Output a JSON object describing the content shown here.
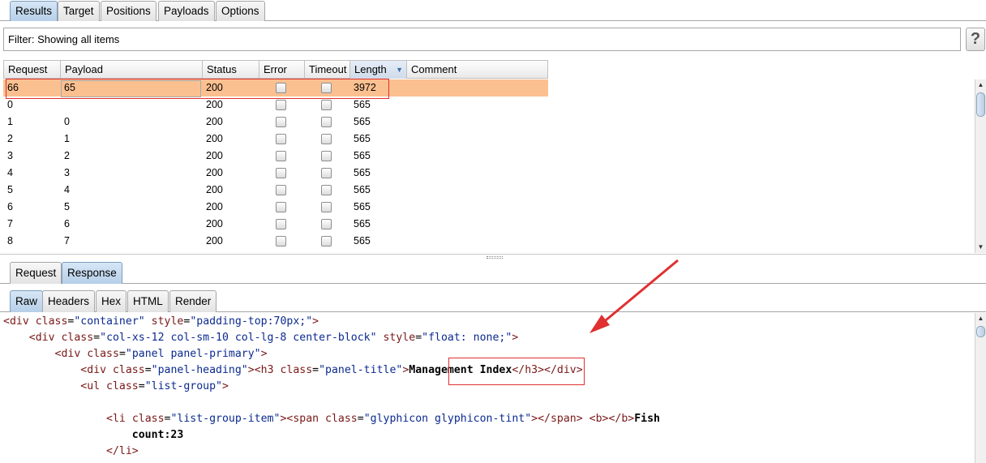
{
  "top_tabs": [
    {
      "label": "Results",
      "active": true
    },
    {
      "label": "Target",
      "active": false
    },
    {
      "label": "Positions",
      "active": false
    },
    {
      "label": "Payloads",
      "active": false
    },
    {
      "label": "Options",
      "active": false
    }
  ],
  "filter": {
    "text": "Filter: Showing all items",
    "help_label": "?"
  },
  "results_table": {
    "columns": [
      "Request",
      "Payload",
      "Status",
      "Error",
      "Timeout",
      "Length",
      "Comment"
    ],
    "sorted_column": "Length",
    "rows": [
      {
        "request": "66",
        "payload": "65",
        "status": "200",
        "error": false,
        "timeout": false,
        "length": "3972",
        "comment": "",
        "selected": true
      },
      {
        "request": "0",
        "payload": "",
        "status": "200",
        "error": false,
        "timeout": false,
        "length": "565",
        "comment": ""
      },
      {
        "request": "1",
        "payload": "0",
        "status": "200",
        "error": false,
        "timeout": false,
        "length": "565",
        "comment": ""
      },
      {
        "request": "2",
        "payload": "1",
        "status": "200",
        "error": false,
        "timeout": false,
        "length": "565",
        "comment": ""
      },
      {
        "request": "3",
        "payload": "2",
        "status": "200",
        "error": false,
        "timeout": false,
        "length": "565",
        "comment": ""
      },
      {
        "request": "4",
        "payload": "3",
        "status": "200",
        "error": false,
        "timeout": false,
        "length": "565",
        "comment": ""
      },
      {
        "request": "5",
        "payload": "4",
        "status": "200",
        "error": false,
        "timeout": false,
        "length": "565",
        "comment": ""
      },
      {
        "request": "6",
        "payload": "5",
        "status": "200",
        "error": false,
        "timeout": false,
        "length": "565",
        "comment": ""
      },
      {
        "request": "7",
        "payload": "6",
        "status": "200",
        "error": false,
        "timeout": false,
        "length": "565",
        "comment": ""
      },
      {
        "request": "8",
        "payload": "7",
        "status": "200",
        "error": false,
        "timeout": false,
        "length": "565",
        "comment": ""
      }
    ]
  },
  "message_tabs": [
    {
      "label": "Request",
      "active": false
    },
    {
      "label": "Response",
      "active": true
    }
  ],
  "view_tabs": [
    {
      "label": "Raw",
      "active": true
    },
    {
      "label": "Headers",
      "active": false
    },
    {
      "label": "Hex",
      "active": false
    },
    {
      "label": "HTML",
      "active": false
    },
    {
      "label": "Render",
      "active": false
    }
  ],
  "response_lines": [
    [
      [
        "t",
        "<div "
      ],
      [
        "a",
        "class"
      ],
      [
        "p",
        "="
      ],
      [
        "v",
        "\"container\""
      ],
      [
        "p",
        " "
      ],
      [
        "a",
        "style"
      ],
      [
        "p",
        "="
      ],
      [
        "v",
        "\"padding-top:70px;\""
      ],
      [
        "t",
        ">"
      ]
    ],
    [
      [
        "p",
        "    "
      ],
      [
        "t",
        "<div "
      ],
      [
        "a",
        "class"
      ],
      [
        "p",
        "="
      ],
      [
        "v",
        "\"col-xs-12 col-sm-10 col-lg-8 center-block\""
      ],
      [
        "p",
        " "
      ],
      [
        "a",
        "style"
      ],
      [
        "p",
        "="
      ],
      [
        "v",
        "\"float: none;\""
      ],
      [
        "t",
        ">"
      ]
    ],
    [
      [
        "p",
        "        "
      ],
      [
        "t",
        "<div "
      ],
      [
        "a",
        "class"
      ],
      [
        "p",
        "="
      ],
      [
        "v",
        "\"panel panel-primary\""
      ],
      [
        "t",
        ">"
      ]
    ],
    [
      [
        "p",
        "            "
      ],
      [
        "t",
        "<div "
      ],
      [
        "a",
        "class"
      ],
      [
        "p",
        "="
      ],
      [
        "v",
        "\"panel-heading\""
      ],
      [
        "t",
        ">"
      ],
      [
        "t",
        "<h3 "
      ],
      [
        "a",
        "class"
      ],
      [
        "p",
        "="
      ],
      [
        "v",
        "\"panel-title\""
      ],
      [
        "t",
        ">"
      ],
      [
        "b",
        "Management Index"
      ],
      [
        "t",
        "</h3>"
      ],
      [
        "t",
        "</div>"
      ]
    ],
    [
      [
        "p",
        "            "
      ],
      [
        "t",
        "<ul "
      ],
      [
        "a",
        "class"
      ],
      [
        "p",
        "="
      ],
      [
        "v",
        "\"list-group\""
      ],
      [
        "t",
        ">"
      ]
    ],
    [
      [
        "p",
        ""
      ]
    ],
    [
      [
        "p",
        "                "
      ],
      [
        "t",
        "<li "
      ],
      [
        "a",
        "class"
      ],
      [
        "p",
        "="
      ],
      [
        "v",
        "\"list-group-item\""
      ],
      [
        "t",
        ">"
      ],
      [
        "t",
        "<span "
      ],
      [
        "a",
        "class"
      ],
      [
        "p",
        "="
      ],
      [
        "v",
        "\"glyphicon glyphicon-tint\""
      ],
      [
        "t",
        ">"
      ],
      [
        "t",
        "</span>"
      ],
      [
        "p",
        " "
      ],
      [
        "t",
        "<b>"
      ],
      [
        "t",
        "</b>"
      ],
      [
        "b",
        "Fish"
      ]
    ],
    [
      [
        "p",
        "                    "
      ],
      [
        "b",
        "count:23"
      ]
    ],
    [
      [
        "p",
        "                "
      ],
      [
        "t",
        "</li>"
      ]
    ]
  ],
  "colors": {
    "selected_row": "#fbc090",
    "highlight_red": "#e03030",
    "tag": "#7a1818",
    "attr_value": "#0b2a8f",
    "active_tab": "#b6cfe8"
  },
  "icons": {
    "sort": "sort-descending-icon",
    "scroll_up": "scroll-up-arrow-icon",
    "scroll_down": "scroll-down-arrow-icon",
    "help": "help-icon"
  }
}
